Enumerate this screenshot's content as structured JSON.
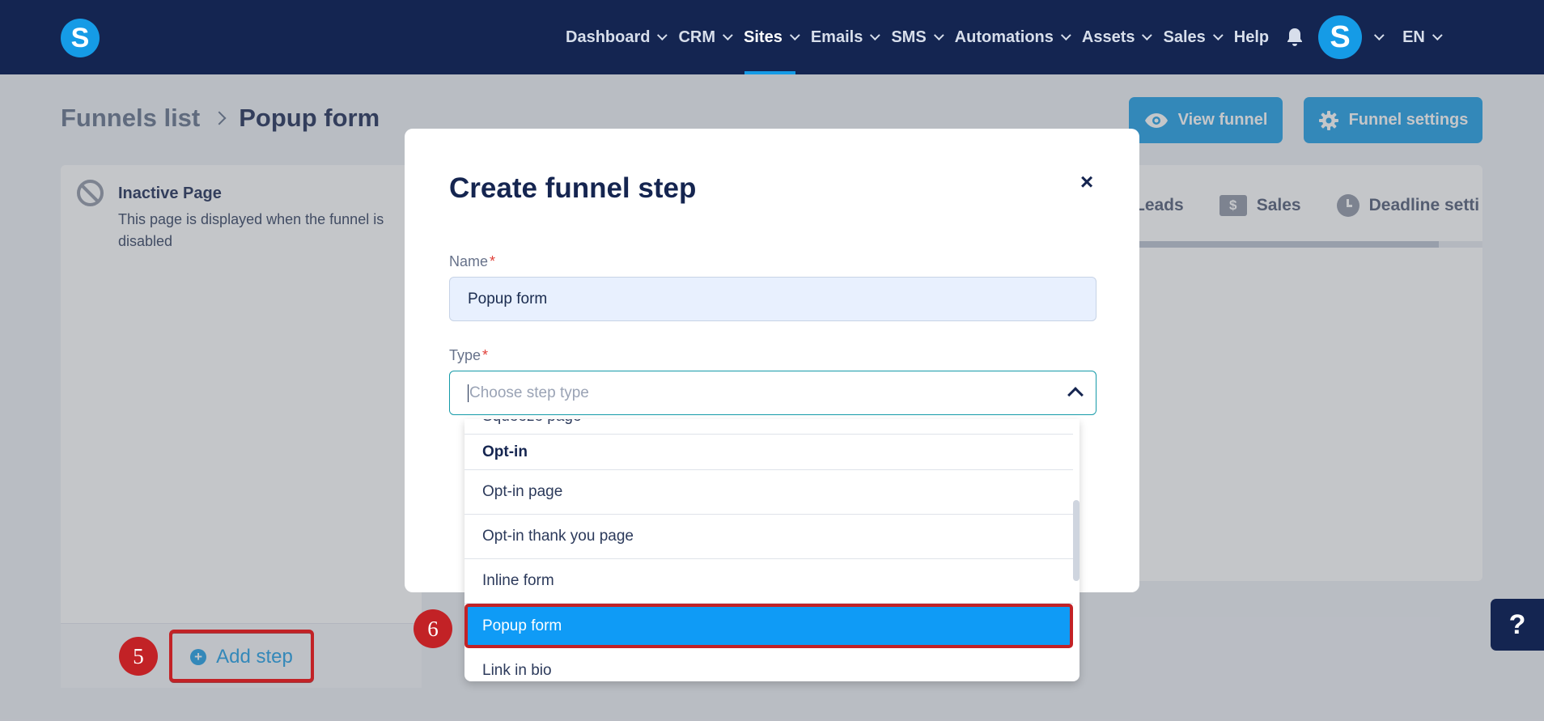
{
  "nav": {
    "items": [
      {
        "label": "Dashboard",
        "has_menu": true,
        "active": false
      },
      {
        "label": "CRM",
        "has_menu": true,
        "active": false
      },
      {
        "label": "Sites",
        "has_menu": true,
        "active": true
      },
      {
        "label": "Emails",
        "has_menu": true,
        "active": false
      },
      {
        "label": "SMS",
        "has_menu": true,
        "active": false
      },
      {
        "label": "Automations",
        "has_menu": true,
        "active": false
      },
      {
        "label": "Assets",
        "has_menu": true,
        "active": false
      },
      {
        "label": "Sales",
        "has_menu": true,
        "active": false
      },
      {
        "label": "Help",
        "has_menu": false,
        "active": false
      }
    ],
    "logo_letter": "S",
    "avatar_letter": "S",
    "language": "EN"
  },
  "page": {
    "breadcrumb_parent": "Funnels list",
    "breadcrumb_current": "Popup form",
    "view_funnel_label": "View funnel",
    "funnel_settings_label": "Funnel settings"
  },
  "left_panel": {
    "title": "Inactive Page",
    "description": "This page is displayed when the funnel is disabled",
    "add_step_label": "Add step",
    "badge_number": "5"
  },
  "right_panel": {
    "tabs": [
      {
        "label": "Leads",
        "icon": "none"
      },
      {
        "label": "Sales",
        "icon": "dollar-icon"
      },
      {
        "label": "Deadline setti",
        "icon": "clock-icon"
      }
    ]
  },
  "modal": {
    "title": "Create funnel step",
    "close_symbol": "×",
    "name_label": "Name",
    "name_value": "Popup form",
    "type_label": "Type",
    "type_placeholder": "Choose step type",
    "required_marker": "*"
  },
  "dropdown": {
    "partial_item": "Squeeze page",
    "group_label": "Opt-in",
    "options": [
      "Opt-in page",
      "Opt-in thank you page",
      "Inline form",
      "Popup form",
      "Link in bio"
    ],
    "selected": "Popup form",
    "badge_number": "6"
  },
  "help_symbol": "?",
  "colors": {
    "navbar": "#142551",
    "accent": "#159be6",
    "highlight": "#c22226",
    "selected_option": "#0f9bf6"
  }
}
